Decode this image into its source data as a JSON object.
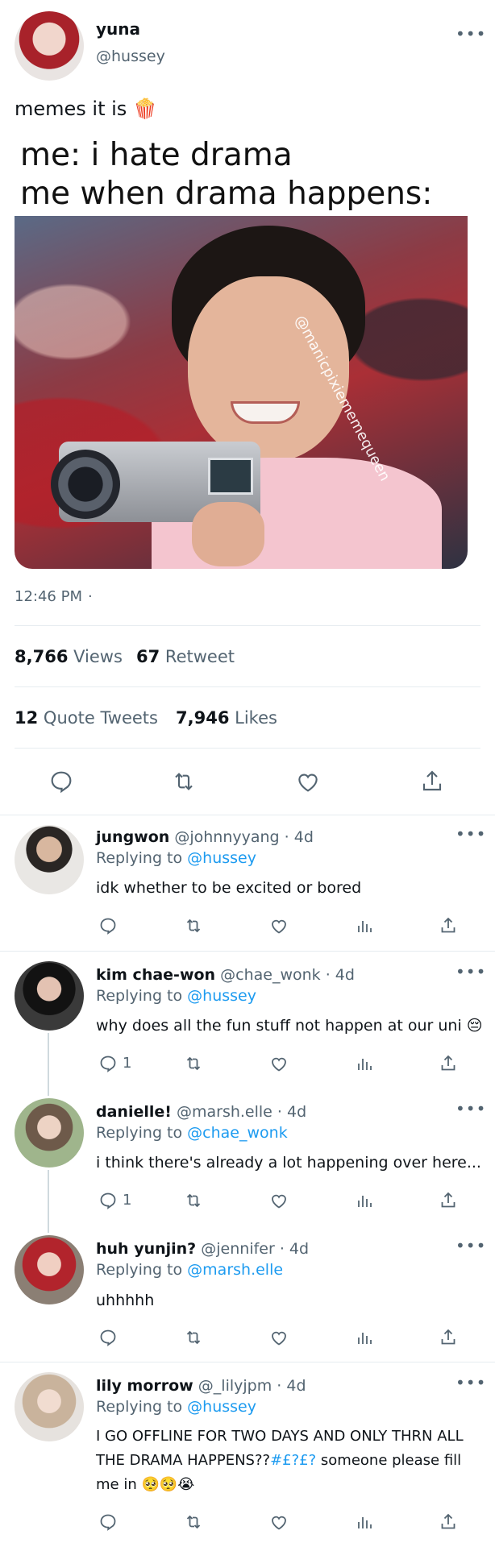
{
  "tweet": {
    "author": {
      "display_name": "yuna",
      "handle": "@hussey"
    },
    "text": "memes it is",
    "emoji": "🍿",
    "meme": {
      "caption_line1": "me: i hate drama",
      "caption_line2": "me when drama happens:",
      "watermark": "@manicpixiememequeen"
    },
    "timestamp": "12:46 PM",
    "separator": "·",
    "stats": {
      "views_count": "8,766",
      "views_label": "Views",
      "retweets_count": "67",
      "retweets_label": "Retweet",
      "quotes_count": "12",
      "quotes_label": "Quote Tweets",
      "likes_count": "7,946",
      "likes_label": "Likes"
    },
    "actions": [
      "reply-icon",
      "retweet-icon",
      "like-icon",
      "share-icon"
    ]
  },
  "replies": [
    {
      "name": "jungwon",
      "handle": "@johnnyyang",
      "time": "· 4d",
      "replying_label": "Replying to",
      "replying_to": "@hussey",
      "text": "idk whether to be excited or bored",
      "reply_count": ""
    },
    {
      "name": "kim chae-won",
      "handle": "@chae_wonk",
      "time": "· 4d",
      "replying_label": "Replying to",
      "replying_to": "@hussey",
      "text": "why does all the fun stuff not happen at our uni",
      "emoji": "😔",
      "reply_count": "1"
    },
    {
      "name": "danielle!",
      "handle": "@marsh.elle",
      "time": "· 4d",
      "replying_label": "Replying to",
      "replying_to": "@chae_wonk",
      "text": "i think there's already a lot happening over here...",
      "reply_count": "1"
    },
    {
      "name": "huh yunjin?",
      "handle": "@jennifer",
      "time": "· 4d",
      "replying_label": "Replying to",
      "replying_to": "@marsh.elle",
      "text": "uhhhhh",
      "reply_count": ""
    },
    {
      "name": "lily morrow",
      "handle": "@_lilyjpm",
      "time": "· 4d",
      "replying_label": "Replying to",
      "replying_to": "@hussey",
      "text_line1": "I GO OFFLINE FOR TWO DAYS AND ONLY THRN ALL",
      "text_line2_a": "THE DRAMA HAPPENS??",
      "text_line2_hashtag": "#£?£?",
      "text_line2_b": " someone please fill",
      "text_line3": "me in",
      "emoji": "🥺🥺😭",
      "reply_count": ""
    }
  ],
  "colors": {
    "accent": "#1d9bf0",
    "text": "#0f1419",
    "muted": "#536471",
    "divider": "#e6ecf0"
  }
}
